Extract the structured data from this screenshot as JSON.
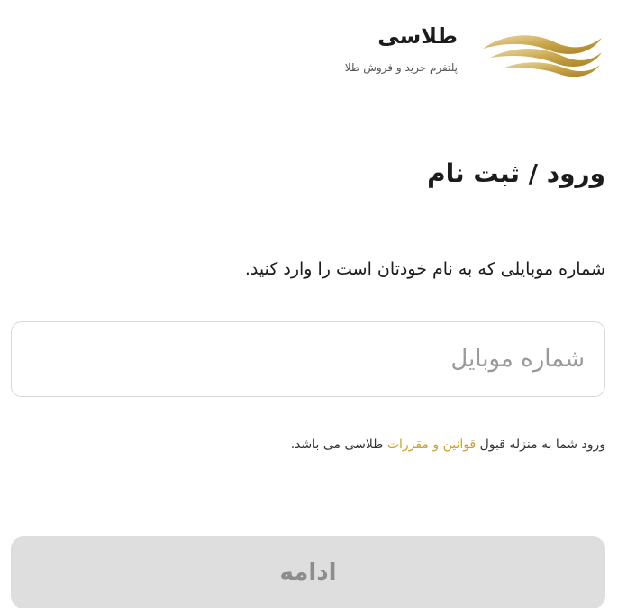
{
  "brand": {
    "name": "طلاسی",
    "tagline": "پلتفرم خرید و فروش طلا",
    "accent_color": "#c9a227",
    "logo_icon": "gold-waves-icon"
  },
  "login": {
    "title": "ورود / ثبت نام",
    "instruction": "شماره موبایلی که به نام خودتان است را وارد کنید.",
    "mobile_input": {
      "value": "",
      "placeholder": "شماره موبایل"
    },
    "terms": {
      "before": "ورود شما به منزله قبول ",
      "link": "قوانین و مقررات",
      "after": " طلاسی می باشد."
    },
    "continue_label": "ادامه"
  }
}
